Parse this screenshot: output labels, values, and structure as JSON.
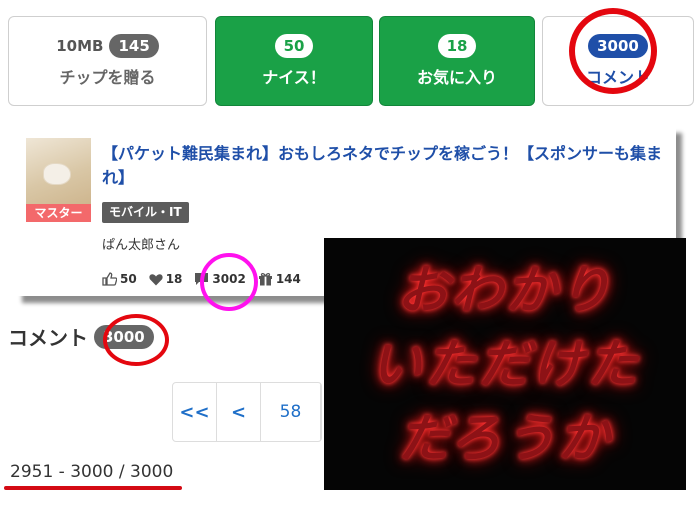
{
  "buttons": {
    "tip": {
      "size": "10MB",
      "count": "145",
      "label": "チップを贈る"
    },
    "nice": {
      "count": "50",
      "label": "ナイス！"
    },
    "favorite": {
      "count": "18",
      "label": "お気に入り"
    },
    "comment": {
      "count": "3000",
      "label": "コメント"
    }
  },
  "article": {
    "badge": "マスター",
    "title": "【パケット難民集まれ】おもしろネタでチップを稼ごう！【スポンサーも集まれ】",
    "category": "モバイル・IT",
    "author": "ぱん太郎さん",
    "stats": {
      "likes": "50",
      "favorites": "18",
      "comments": "3002",
      "tips": "144"
    }
  },
  "comments": {
    "heading": "コメント",
    "count": "3000"
  },
  "pagination": {
    "first": "<<",
    "prev": "<",
    "page": "58"
  },
  "range": "2951 - 3000 / 3000",
  "overlay": {
    "lines": [
      "おわかり",
      "いただけた",
      "だろうか"
    ]
  },
  "colors": {
    "green": "#1aa147",
    "navy": "#1f4fa8",
    "annotation_red": "#e4070f",
    "annotation_magenta": "#ff11ee"
  }
}
